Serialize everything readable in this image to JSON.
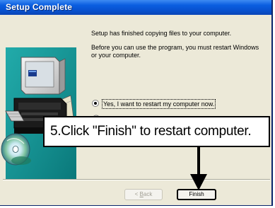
{
  "window": {
    "title": "Setup Complete"
  },
  "message": {
    "line1": "Setup has finished copying files to your computer.",
    "line2": "Before you can use the program, you must restart Windows or your computer."
  },
  "options": {
    "restart_now": "Yes, I want to restart my computer now.",
    "selected": "restart_now"
  },
  "buttons": {
    "back_prefix": "< ",
    "back_accel": "B",
    "back_rest": "ack",
    "finish": "Finish"
  },
  "callout": {
    "text": "5.Click \"Finish\" to restart computer."
  },
  "icons": [
    "computer-illustration",
    "cd-disc-icon",
    "arrow-down-icon"
  ],
  "colors": {
    "titlebar": "#0a5ee0",
    "dialog_bg": "#ece9d8",
    "panel_teal": "#0e8a8a"
  }
}
